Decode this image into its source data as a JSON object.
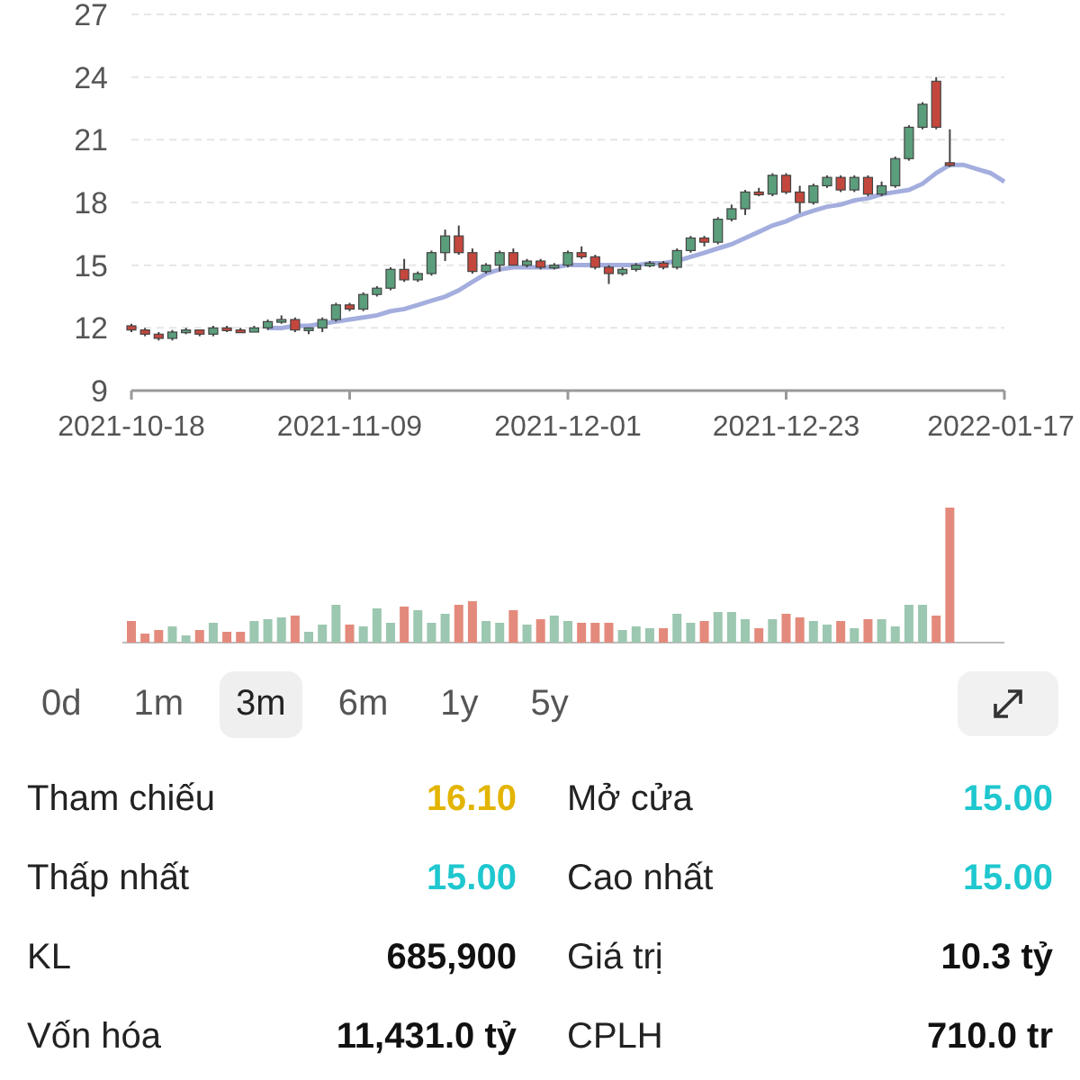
{
  "price_chart": {
    "chart_data": {
      "type": "candlestick",
      "categories": [
        "2021-10-18",
        null,
        null,
        null,
        null,
        null,
        null,
        null,
        null,
        null,
        null,
        null,
        null,
        null,
        null,
        null,
        "2021-11-09",
        null,
        null,
        null,
        null,
        null,
        null,
        null,
        null,
        null,
        null,
        null,
        null,
        null,
        null,
        null,
        "2021-12-01",
        null,
        null,
        null,
        null,
        null,
        null,
        null,
        null,
        null,
        null,
        null,
        null,
        null,
        null,
        null,
        "2021-12-23",
        null,
        null,
        null,
        null,
        null,
        null,
        null,
        null,
        null,
        null,
        null,
        null,
        null,
        null,
        null,
        "2022-01-17"
      ],
      "ohlc": [
        [
          12.1,
          12.2,
          11.8,
          11.9
        ],
        [
          11.9,
          12.0,
          11.6,
          11.7
        ],
        [
          11.7,
          11.8,
          11.4,
          11.5
        ],
        [
          11.5,
          11.9,
          11.4,
          11.8
        ],
        [
          11.8,
          12.0,
          11.7,
          11.9
        ],
        [
          11.9,
          11.9,
          11.6,
          11.7
        ],
        [
          11.7,
          12.1,
          11.6,
          12.0
        ],
        [
          12.0,
          12.1,
          11.8,
          11.9
        ],
        [
          11.9,
          12.0,
          11.8,
          11.8
        ],
        [
          11.8,
          12.1,
          11.8,
          12.0
        ],
        [
          12.0,
          12.4,
          11.9,
          12.3
        ],
        [
          12.3,
          12.6,
          12.2,
          12.4
        ],
        [
          12.4,
          12.5,
          11.8,
          11.9
        ],
        [
          11.9,
          12.0,
          11.7,
          12.0
        ],
        [
          12.0,
          12.5,
          11.8,
          12.4
        ],
        [
          12.4,
          13.2,
          12.3,
          13.1
        ],
        [
          13.1,
          13.2,
          12.8,
          12.9
        ],
        [
          12.9,
          13.7,
          12.8,
          13.6
        ],
        [
          13.6,
          14.0,
          13.5,
          13.9
        ],
        [
          13.9,
          14.9,
          13.8,
          14.8
        ],
        [
          14.8,
          15.3,
          14.2,
          14.3
        ],
        [
          14.3,
          14.7,
          14.2,
          14.6
        ],
        [
          14.6,
          15.7,
          14.5,
          15.6
        ],
        [
          15.6,
          16.7,
          15.2,
          16.4
        ],
        [
          16.4,
          16.9,
          15.5,
          15.6
        ],
        [
          15.6,
          15.8,
          14.6,
          14.7
        ],
        [
          14.7,
          15.1,
          14.6,
          15.0
        ],
        [
          15.0,
          15.7,
          14.7,
          15.6
        ],
        [
          15.6,
          15.8,
          15.0,
          15.0
        ],
        [
          15.0,
          15.3,
          14.9,
          15.2
        ],
        [
          15.2,
          15.3,
          14.8,
          14.9
        ],
        [
          14.9,
          15.1,
          14.8,
          15.0
        ],
        [
          15.0,
          15.7,
          14.9,
          15.6
        ],
        [
          15.6,
          15.9,
          15.3,
          15.4
        ],
        [
          15.4,
          15.5,
          14.8,
          14.9
        ],
        [
          14.9,
          15.0,
          14.1,
          14.6
        ],
        [
          14.6,
          14.9,
          14.5,
          14.8
        ],
        [
          14.8,
          15.1,
          14.7,
          15.0
        ],
        [
          15.0,
          15.2,
          14.9,
          15.1
        ],
        [
          15.1,
          15.2,
          14.8,
          14.9
        ],
        [
          14.9,
          15.8,
          14.8,
          15.7
        ],
        [
          15.7,
          16.4,
          15.6,
          16.3
        ],
        [
          16.3,
          16.4,
          15.9,
          16.1
        ],
        [
          16.1,
          17.3,
          16.0,
          17.2
        ],
        [
          17.2,
          17.9,
          17.1,
          17.7
        ],
        [
          17.7,
          18.6,
          17.4,
          18.5
        ],
        [
          18.5,
          18.7,
          18.3,
          18.4
        ],
        [
          18.4,
          19.4,
          18.3,
          19.3
        ],
        [
          19.3,
          19.4,
          18.4,
          18.5
        ],
        [
          18.5,
          18.8,
          17.5,
          18.0
        ],
        [
          18.0,
          18.9,
          17.9,
          18.8
        ],
        [
          18.8,
          19.3,
          18.7,
          19.2
        ],
        [
          19.2,
          19.3,
          18.5,
          18.6
        ],
        [
          18.6,
          19.3,
          18.5,
          19.2
        ],
        [
          19.2,
          19.3,
          18.3,
          18.4
        ],
        [
          18.4,
          19.0,
          18.3,
          18.8
        ],
        [
          18.8,
          20.2,
          18.7,
          20.1
        ],
        [
          20.1,
          21.7,
          20.0,
          21.6
        ],
        [
          21.6,
          22.8,
          21.5,
          22.7
        ],
        [
          23.8,
          24.0,
          21.5,
          21.6
        ],
        [
          19.9,
          21.5,
          19.7,
          19.8
        ],
        null,
        null,
        null,
        null
      ],
      "grid": true,
      "series": [
        {
          "type": "line",
          "color": "#a4aede",
          "values": [
            null,
            null,
            null,
            null,
            null,
            null,
            null,
            null,
            null,
            null,
            12.0,
            12.0,
            12.1,
            12.1,
            12.2,
            12.3,
            12.4,
            12.5,
            12.6,
            12.8,
            12.9,
            13.1,
            13.3,
            13.5,
            13.8,
            14.2,
            14.6,
            14.8,
            14.9,
            14.9,
            14.9,
            14.9,
            15.0,
            15.0,
            15.0,
            15.0,
            15.0,
            15.0,
            15.1,
            15.1,
            15.2,
            15.4,
            15.6,
            15.8,
            16.0,
            16.3,
            16.6,
            16.9,
            17.1,
            17.4,
            17.6,
            17.8,
            17.9,
            18.1,
            18.2,
            18.4,
            18.5,
            18.6,
            18.9,
            19.4,
            19.8,
            19.8,
            19.6,
            19.4,
            19.0
          ]
        }
      ],
      "ylim": [
        9,
        27
      ],
      "yticks": [
        9,
        12,
        15,
        18,
        21,
        24,
        27
      ]
    }
  },
  "ranges": [
    {
      "label": "0d",
      "selected": false
    },
    {
      "label": "1m",
      "selected": false
    },
    {
      "label": "3m",
      "selected": true
    },
    {
      "label": "6m",
      "selected": false
    },
    {
      "label": "1y",
      "selected": false
    },
    {
      "label": "5y",
      "selected": false
    }
  ],
  "stats": [
    {
      "label": "Tham chiếu",
      "value": "16.10",
      "color": "#e3b400"
    },
    {
      "label": "Mở cửa",
      "value": "15.00",
      "color": "#1fc7cf"
    },
    {
      "label": "Thấp nhất",
      "value": "15.00",
      "color": "#1fc7cf"
    },
    {
      "label": "Cao nhất",
      "value": "15.00",
      "color": "#1fc7cf"
    },
    {
      "label": "KL",
      "value": "685,900",
      "color": "#111111"
    },
    {
      "label": "Giá trị",
      "value": "10.3 tỷ",
      "color": "#111111"
    },
    {
      "label": "Vốn hóa",
      "value": "11,431.0 tỷ",
      "color": "#111111"
    },
    {
      "label": "CPLH",
      "value": "710.0 tr",
      "color": "#111111"
    }
  ]
}
